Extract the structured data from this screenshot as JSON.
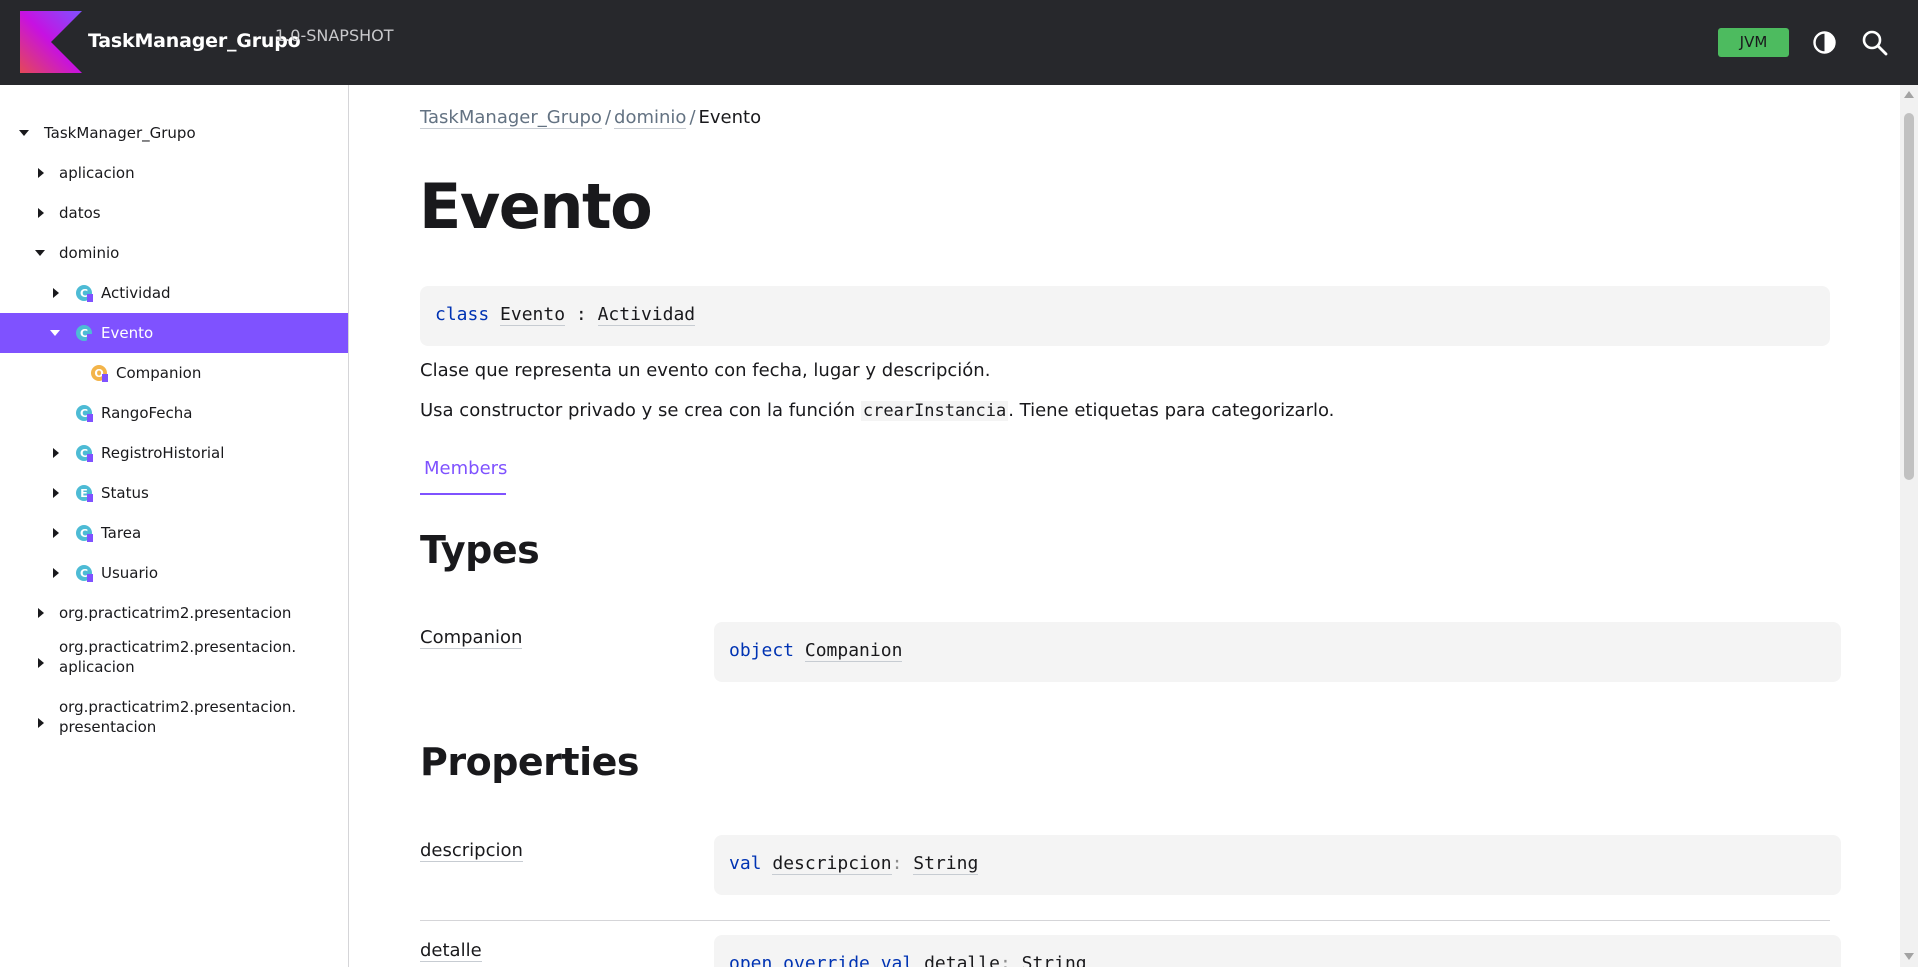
{
  "header": {
    "title": "TaskManager_Grupo",
    "version": "1.0-SNAPSHOT",
    "platform_badge": "JVM",
    "theme_icon": "contrast-icon",
    "search_icon": "search-icon",
    "colors": {
      "background": "#27282c",
      "badge": "#4dbb5f",
      "accent": "#7f52ff"
    }
  },
  "sidebar": {
    "items": [
      {
        "label": "TaskManager_Grupo",
        "expanded": true
      },
      {
        "label": "aplicacion",
        "expanded": false
      },
      {
        "label": "datos",
        "expanded": false
      },
      {
        "label": "dominio",
        "expanded": true
      },
      {
        "label": "Actividad",
        "expanded": false,
        "icon": "class-icon"
      },
      {
        "label": "Evento",
        "expanded": true,
        "icon": "class-icon",
        "selected": true
      },
      {
        "label": "Companion",
        "icon": "object-icon"
      },
      {
        "label": "RangoFecha",
        "icon": "class-icon"
      },
      {
        "label": "RegistroHistorial",
        "expanded": false,
        "icon": "class-icon"
      },
      {
        "label": "Status",
        "expanded": false,
        "icon": "class-icon"
      },
      {
        "label": "Tarea",
        "expanded": false,
        "icon": "class-icon"
      },
      {
        "label": "Usuario",
        "expanded": false,
        "icon": "class-icon"
      },
      {
        "label": "org.practicatrim2.presentacion",
        "expanded": false
      },
      {
        "label": "org.practicatrim2.presentacion.\naplicacion",
        "expanded": false
      },
      {
        "label": "org.practicatrim2.presentacion.\npresentacion",
        "expanded": false
      }
    ]
  },
  "breadcrumb": {
    "items": [
      "TaskManager_Grupo",
      "dominio"
    ],
    "current": "Evento",
    "separator": "/"
  },
  "page": {
    "title": "Evento",
    "signature": {
      "keyword": "class",
      "name": "Evento",
      "colon": ":",
      "supertype": "Actividad"
    },
    "description_1": "Clase que representa un evento con fecha, lugar y descripción.",
    "description_2_before": "Usa constructor privado y se crea con la función ",
    "description_2_code": "crearInstancia",
    "description_2_after": ". Tiene etiquetas para categorizarlo.",
    "tab": "Members"
  },
  "sections": {
    "types": {
      "title": "Types",
      "members": [
        {
          "name": "Companion",
          "keyword": "object",
          "sig_name": "Companion"
        }
      ]
    },
    "properties": {
      "title": "Properties",
      "members": [
        {
          "name": "descripcion",
          "keyword": "val",
          "sig_name": "descripcion",
          "colon": ":",
          "type": "String"
        },
        {
          "name": "detalle",
          "keyword": "open override val",
          "sig_name": "detalle",
          "colon": ":",
          "type": "String"
        }
      ]
    }
  }
}
